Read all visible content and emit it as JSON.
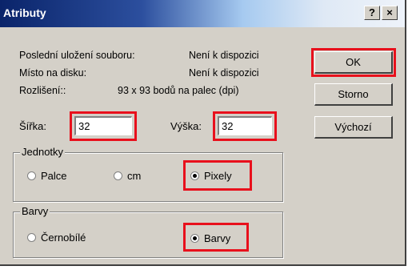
{
  "window": {
    "title": "Atributy",
    "help_btn": "?",
    "close_btn": "×"
  },
  "info": {
    "last_saved_label": "Poslední uložení souboru:",
    "last_saved_value": "Není k dispozici",
    "disk_size_label": "Místo na disku:",
    "disk_size_value": "Není k dispozici",
    "resolution_label": "Rozlišení::",
    "resolution_value": "93 x 93 bodů na palec (dpi)"
  },
  "size": {
    "width_label": "Šířka:",
    "width_value": "32",
    "height_label": "Výška:",
    "height_value": "32"
  },
  "units": {
    "title": "Jednotky",
    "options": [
      "Palce",
      "cm",
      "Pixely"
    ],
    "selected": "Pixely"
  },
  "colors": {
    "title": "Barvy",
    "options": [
      "Černobílé",
      "Barvy"
    ],
    "selected": "Barvy"
  },
  "buttons": {
    "ok": "OK",
    "cancel": "Storno",
    "default": "Výchozí"
  },
  "highlight_color": "#e8101c"
}
